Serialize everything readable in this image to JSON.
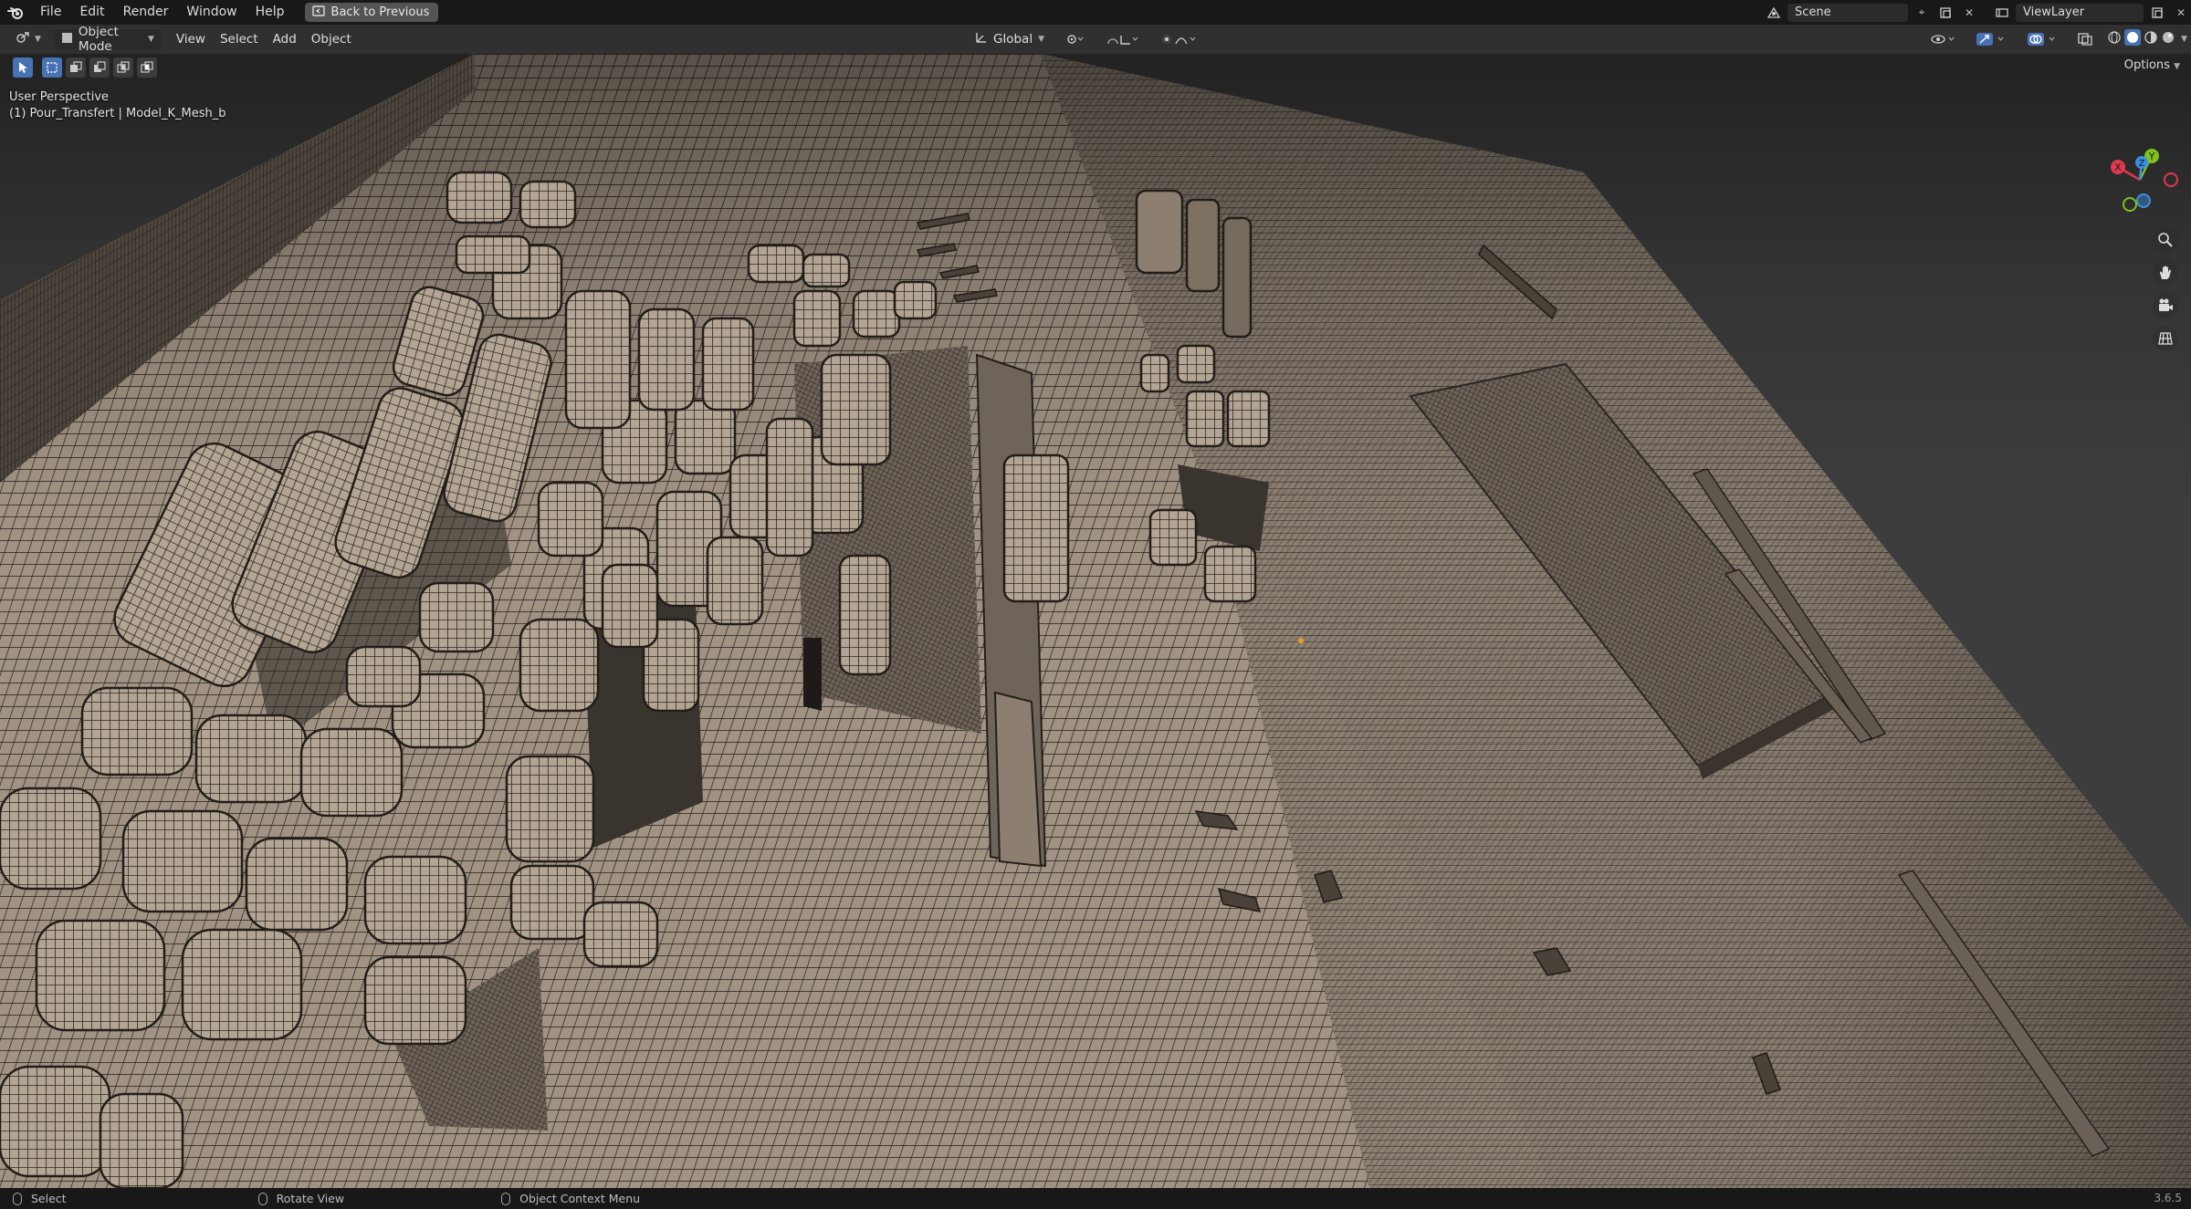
{
  "menu": {
    "items": [
      "File",
      "Edit",
      "Render",
      "Window",
      "Help"
    ],
    "back_button": "Back to Previous"
  },
  "top_right": {
    "scene_name": "Scene",
    "view_layer": "ViewLayer"
  },
  "header": {
    "mode": "Object Mode",
    "menus": [
      "View",
      "Select",
      "Add",
      "Object"
    ],
    "transform_orientation": "Global",
    "options": "Options"
  },
  "viewport": {
    "view_name": "User Perspective",
    "object_info": "(1) Pour_Transfert | Model_K_Mesh_b",
    "gizmo_axes": {
      "x": "X",
      "y": "Y",
      "z": "Z"
    }
  },
  "statusbar": {
    "select": "Select",
    "rotate": "Rotate View",
    "context": "Object Context Menu",
    "version": "3.6.5"
  },
  "colors": {
    "accent": "#4772b3",
    "mesh": "#9a8d80",
    "axis_x": "#e0394d",
    "axis_y": "#7ec21d",
    "axis_z": "#3b8fe0"
  }
}
